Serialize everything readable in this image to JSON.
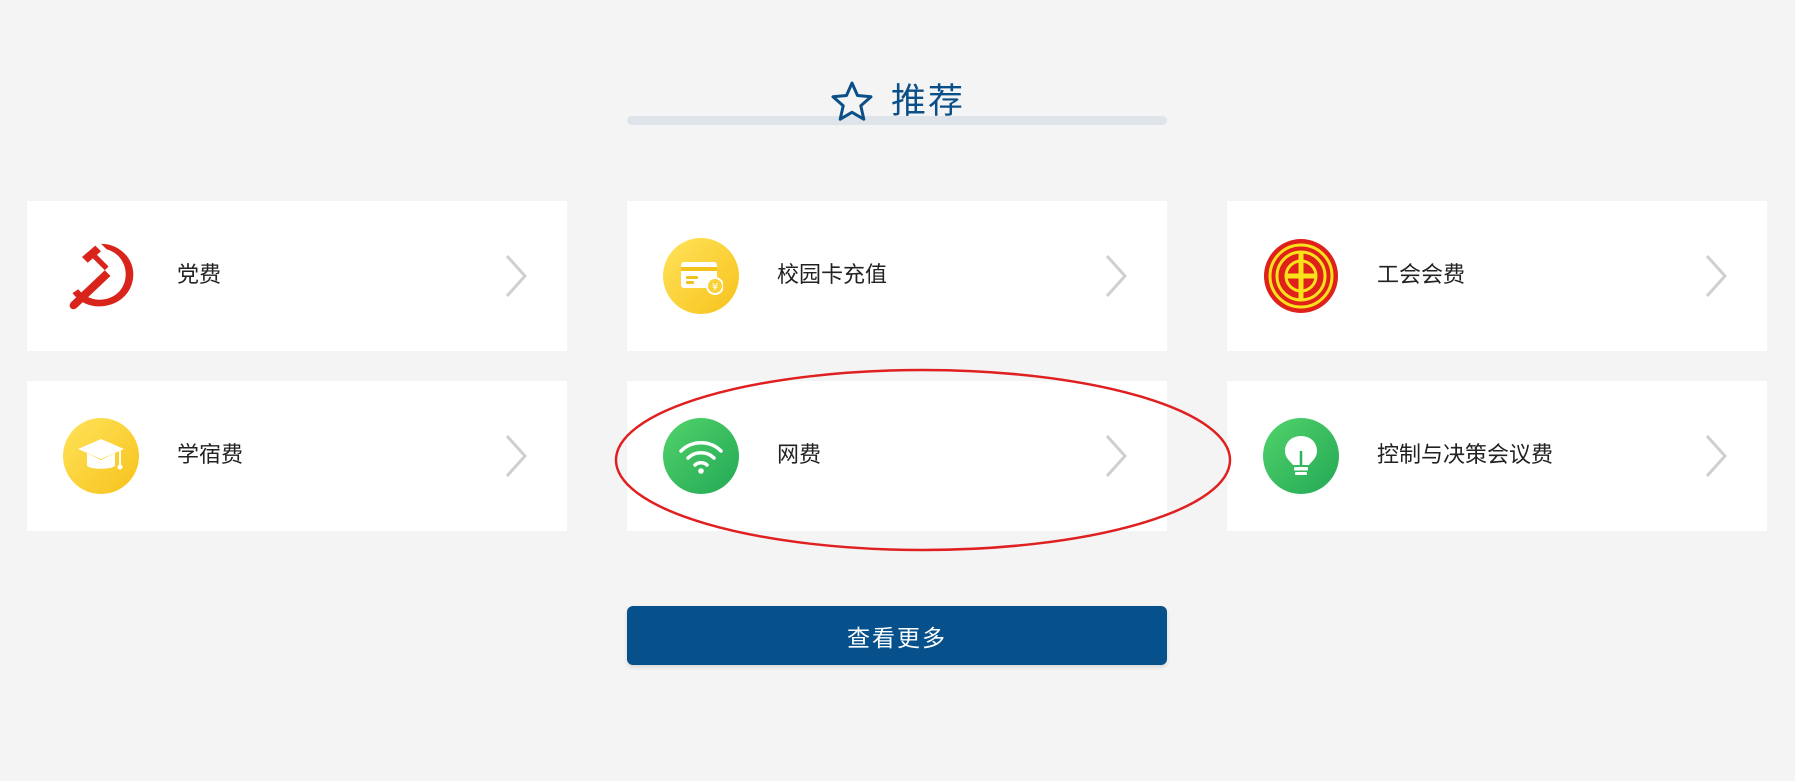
{
  "section": {
    "title": "推荐",
    "icon": "star-icon"
  },
  "colors": {
    "accent": "#0b4f88",
    "button": "#06518c",
    "annotation": "#e02020"
  },
  "items": [
    {
      "label": "党费",
      "icon": "hammer-sickle-icon"
    },
    {
      "label": "校园卡充值",
      "icon": "card-recharge-icon"
    },
    {
      "label": "工会会费",
      "icon": "trade-union-emblem-icon"
    },
    {
      "label": "学宿费",
      "icon": "graduation-cap-icon"
    },
    {
      "label": "网费",
      "icon": "wifi-icon"
    },
    {
      "label": "控制与决策会议费",
      "icon": "lightbulb-icon"
    }
  ],
  "more_button": {
    "label": "查看更多"
  }
}
